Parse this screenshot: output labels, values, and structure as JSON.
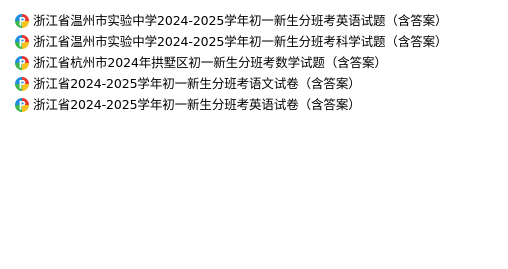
{
  "files": [
    {
      "name": "浙江省温州市实验中学2024-2025学年初一新生分班考英语试题（含答案）",
      "icon": "file-type-icon"
    },
    {
      "name": "浙江省温州市实验中学2024-2025学年初一新生分班考科学试题（含答案）",
      "icon": "file-type-icon"
    },
    {
      "name": "浙江省杭州市2024年拱墅区初一新生分班考数学试题（含答案）",
      "icon": "file-type-icon"
    },
    {
      "name": "浙江省2024-2025学年初一新生分班考语文试卷（含答案）",
      "icon": "file-type-icon"
    },
    {
      "name": "浙江省2024-2025学年初一新生分班考英语试卷（含答案）",
      "icon": "file-type-icon"
    }
  ],
  "colors": {
    "icon_red": "#e8382f",
    "icon_yellow": "#f7c21b",
    "icon_green": "#3cb64a",
    "icon_blue": "#1d8fe1",
    "icon_center": "#ffffff"
  }
}
